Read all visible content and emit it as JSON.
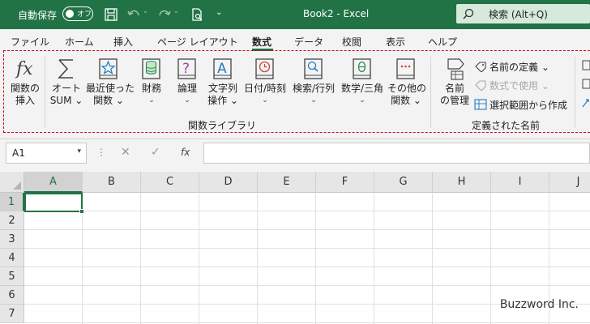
{
  "titlebar": {
    "autosave_label": "自動保存",
    "toggle_label": "オフ",
    "doc_title": "Book2  -  Excel",
    "search_placeholder": "検索 (Alt+Q)"
  },
  "tabs": [
    {
      "label": "ファイル"
    },
    {
      "label": "ホーム"
    },
    {
      "label": "挿入"
    },
    {
      "label": "ページ レイアウト"
    },
    {
      "label": "数式",
      "active": true
    },
    {
      "label": "データ"
    },
    {
      "label": "校閲"
    },
    {
      "label": "表示"
    },
    {
      "label": "ヘルプ"
    }
  ],
  "ribbon": {
    "function_library": {
      "group_label": "関数ライブラリ",
      "buttons": [
        {
          "line1": "関数の",
          "line2": "挿入",
          "icon": "fx-icon"
        },
        {
          "line1": "オート",
          "line2": "SUM ⌄",
          "icon": "sigma-icon"
        },
        {
          "line1": "最近使った",
          "line2": "関数 ⌄",
          "icon": "star-icon"
        },
        {
          "line1": "財務",
          "line2": "⌄",
          "icon": "coins-icon"
        },
        {
          "line1": "論理",
          "line2": "⌄",
          "icon": "question-book-icon"
        },
        {
          "line1": "文字列",
          "line2": "操作 ⌄",
          "icon": "text-book-icon"
        },
        {
          "line1": "日付/時刻",
          "line2": "⌄",
          "icon": "clock-book-icon"
        },
        {
          "line1": "検索/行列",
          "line2": "⌄",
          "icon": "magnifier-book-icon"
        },
        {
          "line1": "数学/三角",
          "line2": "⌄",
          "icon": "theta-book-icon"
        },
        {
          "line1": "その他の",
          "line2": "関数 ⌄",
          "icon": "more-book-icon"
        }
      ]
    },
    "defined_names": {
      "group_label": "定義された名前",
      "manager_line1": "名前",
      "manager_line2": "の管理",
      "define_name": "名前の定義  ⌄",
      "use_in_formula": "数式で使用 ⌄",
      "create_from_selection": "選択範囲から作成"
    }
  },
  "formula_bar": {
    "name_box": "A1",
    "fx_label": "fx",
    "formula": ""
  },
  "sheet": {
    "columns": [
      "A",
      "B",
      "C",
      "D",
      "E",
      "F",
      "G",
      "H",
      "I",
      "J"
    ],
    "rows": [
      "1",
      "2",
      "3",
      "4",
      "5",
      "6",
      "7"
    ],
    "selected_cell": "A1"
  },
  "watermark": "Buzzword Inc.",
  "colors": {
    "accent": "#217346",
    "highlight": "#d0021b"
  }
}
